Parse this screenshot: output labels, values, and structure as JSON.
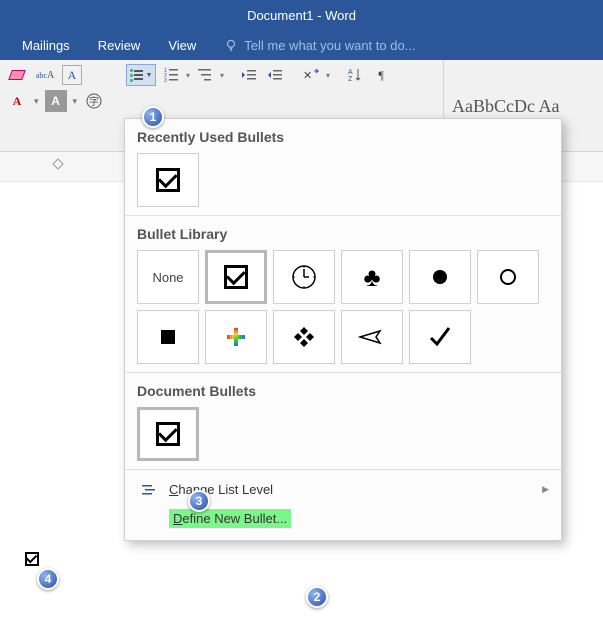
{
  "titlebar": {
    "title": "Document1 - Word"
  },
  "tabs": {
    "mailings": "Mailings",
    "review": "Review",
    "view": "View",
    "tell_me": "Tell me what you want to do..."
  },
  "styles_gallery": {
    "preview": "AaBbCcDc   Aa"
  },
  "dropdown": {
    "recent_title": "Recently Used Bullets",
    "library_title": "Bullet Library",
    "document_title": "Document Bullets",
    "none_label": "None",
    "change_list_level": "Change List Level",
    "define_new_bullet": "Define New Bullet..."
  },
  "badges": {
    "one": "1",
    "two": "2",
    "three": "3",
    "four": "4"
  }
}
